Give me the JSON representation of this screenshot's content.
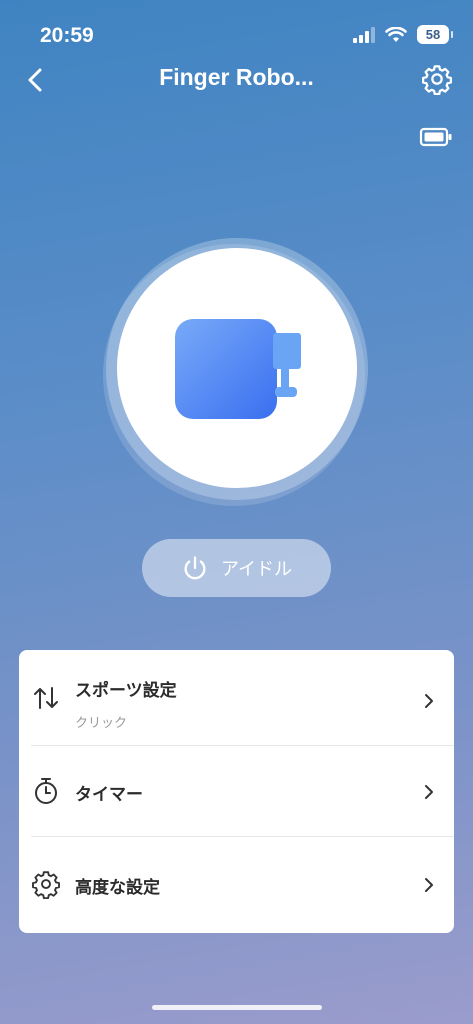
{
  "status_bar": {
    "time": "20:59",
    "battery_level": "58",
    "signal_icon": "cellular-signal-icon",
    "wifi_icon": "wifi-icon"
  },
  "header": {
    "title": "Finger Robo...",
    "back_icon": "chevron-left-icon",
    "settings_icon": "gear-icon",
    "battery_icon": "battery-icon"
  },
  "device": {
    "icon": "finger-robot-icon"
  },
  "state_button": {
    "label": "アイドル",
    "icon": "power-icon"
  },
  "menu": {
    "items": [
      {
        "label": "スポーツ設定",
        "sublabel": "クリック",
        "icon": "swap-vertical-icon"
      },
      {
        "label": "タイマー",
        "icon": "stopwatch-icon"
      },
      {
        "label": "高度な設定",
        "icon": "gear-icon"
      }
    ]
  },
  "colors": {
    "accent": "#3f7ee8",
    "accent_light": "#6aa0f5",
    "background_top": "#3f84c2",
    "background_bottom": "#9a9ccc"
  }
}
